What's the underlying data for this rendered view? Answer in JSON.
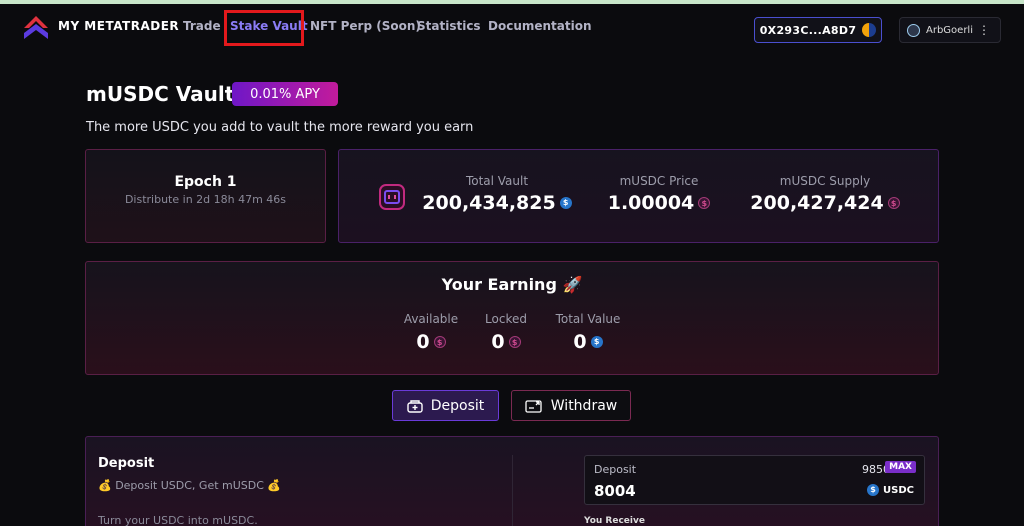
{
  "nav": {
    "brand": "MY METATRADER",
    "links": [
      "Trade",
      "Stake Vault",
      "NFT Perp (Soon)",
      "Statistics",
      "Documentation"
    ],
    "wallet": "0X293C...A8D7",
    "network": "ArbGoerli",
    "menu_glyph": "⋮"
  },
  "vault": {
    "title": "mUSDC Vault",
    "apy": "0.01% APY",
    "subtitle": "The more USDC you add to vault the more reward you earn"
  },
  "epoch": {
    "title": "Epoch 1",
    "countdown": "Distribute in 2d 18h 47m 46s"
  },
  "stats": {
    "total_vault_label": "Total Vault",
    "total_vault_value": "200,434,825",
    "price_label": "mUSDC Price",
    "price_value": "1.00004",
    "supply_label": "mUSDC Supply",
    "supply_value": "200,427,424"
  },
  "earning": {
    "title": "Your Earning 🚀",
    "available_label": "Available",
    "available_value": "0",
    "locked_label": "Locked",
    "locked_value": "0",
    "total_label": "Total Value",
    "total_value": "0"
  },
  "actions": {
    "deposit": "Deposit",
    "withdraw": "Withdraw"
  },
  "deposit_panel": {
    "title": "Deposit",
    "subtitle": "💰 Deposit USDC, Get mUSDC 💰",
    "description": "Turn your USDC into mUSDC.",
    "input_label": "Deposit",
    "balance": "9850",
    "max_label": "MAX",
    "amount": "8004",
    "token": "USDC",
    "receive_label": "You Receive"
  },
  "colors": {
    "accent": "#8b7cf6",
    "apy_gradient_start": "#6f17c7",
    "apy_gradient_end": "#c21b9b",
    "usdc": "#2775ca",
    "highlight": "#e3191c"
  },
  "icons": [
    "logo-icon",
    "wallet-avatar-icon",
    "network-icon",
    "menu-icon",
    "vault-icon",
    "usdc-icon",
    "musdc-icon",
    "deposit-icon",
    "withdraw-icon"
  ]
}
